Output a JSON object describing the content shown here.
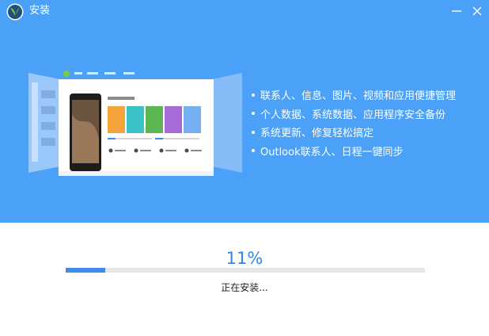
{
  "window": {
    "title": "安装"
  },
  "titlebar": {
    "minimize_icon": "minimize-icon",
    "close_icon": "close-icon"
  },
  "colors": {
    "header_bg": "#4ba0f7",
    "progress_fill": "#3b8de9",
    "progress_track": "#e6e6e6",
    "percent_text": "#2f86e6"
  },
  "features": [
    "联系人、信息、图片、视频和应用便捷管理",
    "个人数据、系统数据、应用程序安全备份",
    "系统更新、修复轻松搞定",
    "Outlook联系人、日程一键同步"
  ],
  "progress": {
    "percent_label": "11%",
    "fraction": 0.11,
    "status": "正在安装..."
  }
}
